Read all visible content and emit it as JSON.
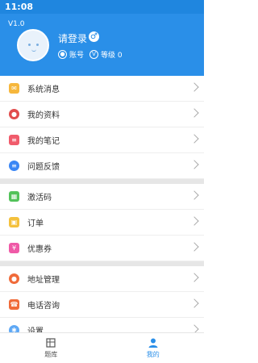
{
  "status": {
    "time": "11:08"
  },
  "profile": {
    "version": "V1.0",
    "login_text": "请登录",
    "gender_symbol": "♂",
    "account_label": "账号",
    "level_label": "等级 0"
  },
  "menu": {
    "group1": [
      {
        "label": "系统消息",
        "icon": "mail-icon",
        "color": "#f6b73c"
      },
      {
        "label": "我的资料",
        "icon": "profile-icon",
        "color": "#e14c4c"
      },
      {
        "label": "我的笔记",
        "icon": "note-icon",
        "color": "#f05b6b"
      },
      {
        "label": "问题反馈",
        "icon": "feedback-icon",
        "color": "#3a86f5"
      }
    ],
    "group2": [
      {
        "label": "激活码",
        "icon": "gift-icon",
        "color": "#52c25a"
      },
      {
        "label": "订单",
        "icon": "bag-icon",
        "color": "#f4c13d"
      },
      {
        "label": "优惠券",
        "icon": "coupon-icon",
        "color": "#ef5aa7"
      }
    ],
    "group3": [
      {
        "label": "地址管理",
        "icon": "location-icon",
        "color": "#f06b3a"
      },
      {
        "label": "电话咨询",
        "icon": "phone-icon",
        "color": "#f06b3a"
      },
      {
        "label": "设置",
        "icon": "gear-icon",
        "color": "#5ea8f5"
      }
    ]
  },
  "tabs": [
    {
      "label": "题库",
      "icon": "bank-icon",
      "active": false
    },
    {
      "label": "我的",
      "icon": "person-icon",
      "active": true
    }
  ]
}
